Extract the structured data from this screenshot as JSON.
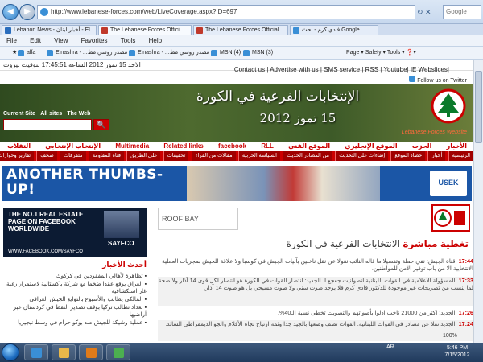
{
  "browser": {
    "url": "http://www.lebanese-forces.com/web/LiveCoverage.aspx?ID=697",
    "search_placeholder": "Google",
    "tabs": [
      {
        "label": "Lebanon News - أخبار لبنان - El..."
      },
      {
        "label": "The Lebanese Forces Offici..."
      },
      {
        "label": "The Lebanese Forces Official ..."
      },
      {
        "label": "فادي كرم - بحث Google"
      }
    ],
    "menu": [
      "File",
      "Edit",
      "View",
      "Favorites",
      "Tools",
      "Help"
    ],
    "favorites": [
      {
        "label": "alfa"
      },
      {
        "label": "Elnashra - ...مصدر روسي مط"
      },
      {
        "label": "Elnashra - ...مصدر روسي مط"
      },
      {
        "label": "MSN (4)"
      },
      {
        "label": "MSN (3)"
      }
    ],
    "command_bar": "Page ▾   Safety ▾   Tools ▾   ❓▾"
  },
  "site": {
    "date_text": "الاحد 15 تموز 2012 الساعة 17:45:51 بتوقيت بيروت",
    "contact_links": "Contact us | Advertise with us | SMS service | RSS | Youtube|   IE Webslices|",
    "follow_twitter": "Follow us on Twitter",
    "search_radio": [
      "Current Site",
      "All sites",
      "The Web"
    ],
    "banner_title": "الإنتخابات الفرعية في الكورة",
    "banner_date": "15 تموز 2012",
    "banner_label": "Lebanese Forces Website",
    "nav1": [
      "الأخبار",
      "الحزب",
      "الموقع الإنجليزي",
      "الموقع الفني",
      "Multimedia",
      "Related links",
      "facebook",
      "RLL",
      "الإنتخاب الإنتخابي",
      "التقلاب"
    ],
    "nav2": [
      "الرئيسية",
      "أخبار",
      "حصاد الموقع",
      "إضاءات على التحديث",
      "من المصادر الحديث",
      "السياسة الحزبية",
      "مقالات من القراء",
      "تحقيقات",
      "على الطريق",
      "قناة المقاومة",
      "متفرقات",
      "صحف",
      "تقارير وحوارات"
    ],
    "ad_strip_text": "ANOTHER THUMBS-UP!",
    "ad_strip_logo": "USEK",
    "left_ad": {
      "headline": "THE NO.1 REAL ESTATE PAGE ON FACEBOOK WORLDWIDE",
      "url": "WWW.FACEBOOK.COM/SAYFCO",
      "brand": "SAYFCO"
    },
    "latest_title": "أحدث الأخبار",
    "latest_items": [
      "▪ تظاهرة لأهالي المفقودين في كركوك",
      "▪ العراق يوقع عقدا ضخما مع شركة باكستانية لاستمرار رغبة غاز استكشافية",
      "▪ المالكي يطالب والأسبوع بالتوابع الجيش العراقي",
      "▪ بغداد تطالب تركيا بوقف تصدير النفط في كردستان عبر أراضيها",
      "▪ عملية وشيكة للجيش ضد بوكو حرام في وسط نيجيريا"
    ],
    "roofbay": "ROOF BAY",
    "live_title": "تغطية مباشرة",
    "live_subtitle": "الانتخابات الفرعية في الكورة",
    "news": [
      {
        "time": "17:44",
        "text": "قناة الجيش: نفي حملة وتفصيلا ما قاله النائب نقولا عن نقل ناخبين بآليات الجيش في كوسبا ولا علاقة للجيش بمجريات العملية الانتخابية الا من باب توفير الأمن للمواطنين."
      },
      {
        "time": "17:33",
        "text": "المسؤولة الاعلامية في القوات اللبنانية انطوانيت جعجع لـ الجديد: انتصار القوات في الكورة هو انتصار لكل قوى 14 آذار ولا صحة لما ينسب من تصريحات غير موجودة للدكتور فادي كرم فلا يوجد صوت سني ولا صوت مسيحي بل هو صوت 14 آذار."
      },
      {
        "time": "17:26",
        "text": "الجديد: اكثر من 21000 ناخب ادلوا بأصواتهم والتصويت تخطى نسبة الـ40%."
      },
      {
        "time": "17:24",
        "text": "الجديد نقلا عن مصادر في القوات اللبنانية: القوات تصف وضعها بالجيد جدا وثمة ارتياح تجاه الأقلام والجو الديمقراطي السائد."
      }
    ],
    "zoom_text": "100%"
  },
  "taskbar": {
    "lang": "AR",
    "time": "5:46 PM",
    "date": "7/15/2012"
  }
}
